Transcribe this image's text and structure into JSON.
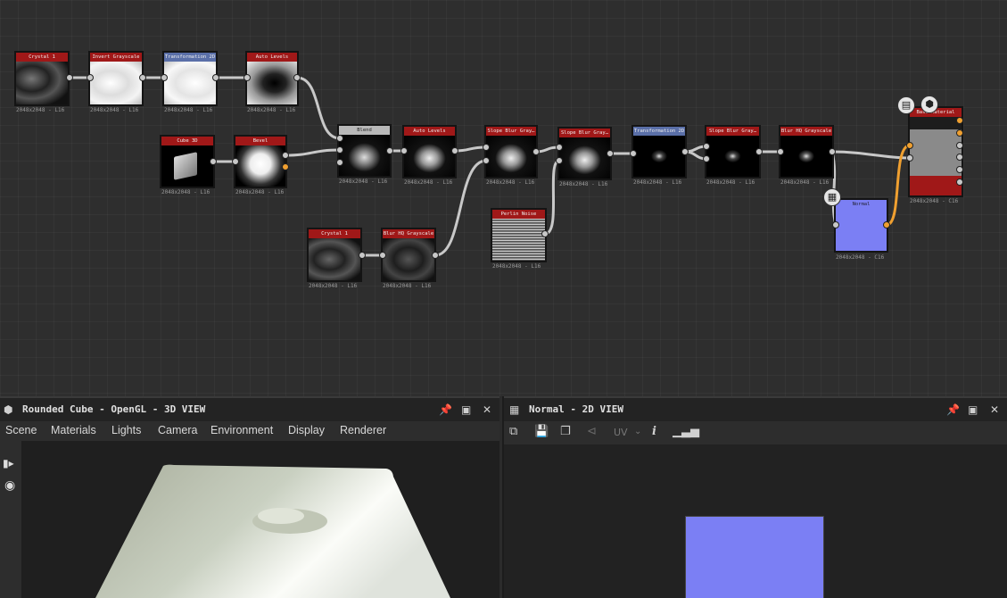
{
  "graph": {
    "nodes": [
      {
        "id": "n1",
        "title": "Crystal 1",
        "caption": "2048x2048 - L16",
        "hdr": "#a01818"
      },
      {
        "id": "n2",
        "title": "Invert Grayscale",
        "caption": "2048x2048 - L16",
        "hdr": "#a01818"
      },
      {
        "id": "n3",
        "title": "Transformation 2D",
        "caption": "2048x2048 - L16",
        "hdr": "#5a6fa8"
      },
      {
        "id": "n4",
        "title": "Auto Levels",
        "caption": "2048x2048 - L16",
        "hdr": "#a01818"
      },
      {
        "id": "n5",
        "title": "Cube 3D",
        "caption": "2048x2048 - L16",
        "hdr": "#a01818"
      },
      {
        "id": "n6",
        "title": "Bevel",
        "caption": "2048x2048 - L16",
        "hdr": "#a01818"
      },
      {
        "id": "n7",
        "title": "Blend",
        "caption": "2048x2048 - L16",
        "hdr": "#b8b8b8"
      },
      {
        "id": "n8",
        "title": "Auto Levels",
        "caption": "2048x2048 - L16",
        "hdr": "#a01818"
      },
      {
        "id": "n9",
        "title": "Slope Blur Gray…",
        "caption": "2048x2048 - L16",
        "hdr": "#a01818"
      },
      {
        "id": "n10",
        "title": "Slope Blur Gray…",
        "caption": "2048x2048 - L16",
        "hdr": "#a01818"
      },
      {
        "id": "n11",
        "title": "Transformation 2D",
        "caption": "2048x2048 - L16",
        "hdr": "#5a6fa8"
      },
      {
        "id": "n12",
        "title": "Slope Blur Gray…",
        "caption": "2048x2048 - L16",
        "hdr": "#a01818"
      },
      {
        "id": "n13",
        "title": "Blur HQ Grayscale",
        "caption": "2048x2048 - L16",
        "hdr": "#a01818"
      },
      {
        "id": "n14",
        "title": "Crystal 1",
        "caption": "2048x2048 - L16",
        "hdr": "#a01818"
      },
      {
        "id": "n15",
        "title": "Blur HQ Grayscale",
        "caption": "2048x2048 - L16",
        "hdr": "#a01818"
      },
      {
        "id": "n16",
        "title": "Perlin Noise",
        "caption": "2048x2048 - L16",
        "hdr": "#a01818"
      },
      {
        "id": "n17",
        "title": "Normal",
        "caption": "2048x2048 - C16",
        "hdr": "#5a6fa8"
      },
      {
        "id": "n18",
        "title": "Base Material",
        "caption": "2048x2048 - C16",
        "hdr": "#a01818"
      }
    ],
    "badges": {
      "doc": "document-icon",
      "cube": "cube-icon",
      "checker": "checker-icon"
    }
  },
  "view3d": {
    "title": "Rounded Cube - OpenGL - 3D VIEW",
    "menu": [
      "Scene",
      "Materials",
      "Lights",
      "Camera",
      "Environment",
      "Display",
      "Renderer"
    ]
  },
  "view2d": {
    "title": "Normal - 2D VIEW",
    "uv_label": "UV",
    "normal_color": "#7b7ff4"
  },
  "colors": {
    "accent": "#f0a030",
    "node_red": "#a01818",
    "node_blue": "#5a6fa8"
  }
}
